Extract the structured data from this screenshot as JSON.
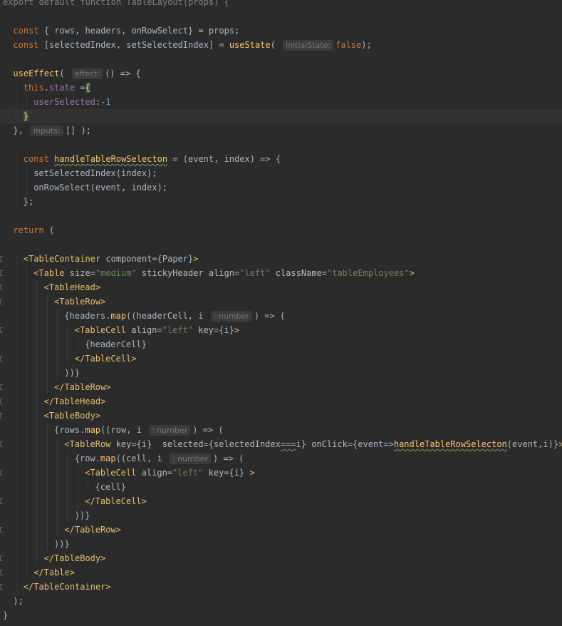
{
  "editor": {
    "colors": {
      "background": "#2b2b2b",
      "keyword": "#cc7832",
      "function": "#ffc66d",
      "string": "#6a8759",
      "jsx_tag": "#e8bf6a",
      "property": "#9876aa",
      "number": "#6897bb",
      "plain": "#a9b7c6",
      "hint_bg": "#3b3b3b"
    },
    "lines": [
      {
        "indent": 0,
        "current": false,
        "tokens": [
          {
            "t": "export default function TableLayout(props) {",
            "c": "dim"
          }
        ]
      },
      {
        "indent": 0,
        "tokens": []
      },
      {
        "indent": 1,
        "tokens": [
          {
            "t": "const",
            "c": "kw"
          },
          {
            "t": " { rows, headers, onRowSelect} = props;",
            "c": "plain"
          }
        ]
      },
      {
        "indent": 1,
        "tokens": [
          {
            "t": "const",
            "c": "kw"
          },
          {
            "t": " [selectedIndex, setSelectedIndex] = ",
            "c": "plain"
          },
          {
            "t": "useState",
            "c": "fn"
          },
          {
            "t": "( ",
            "c": "plain"
          },
          {
            "t": "initialState:",
            "c": "hint"
          },
          {
            "t": "false",
            "c": "kw"
          },
          {
            "t": ");",
            "c": "plain"
          }
        ]
      },
      {
        "indent": 0,
        "tokens": []
      },
      {
        "indent": 1,
        "tokens": [
          {
            "t": "useEffect",
            "c": "fn"
          },
          {
            "t": "( ",
            "c": "plain"
          },
          {
            "t": "effect:",
            "c": "hint"
          },
          {
            "t": "() => {",
            "c": "plain"
          }
        ]
      },
      {
        "indent": 2,
        "tokens": [
          {
            "t": "this",
            "c": "kw"
          },
          {
            "t": ".",
            "c": "plain"
          },
          {
            "t": "state",
            "c": "prop"
          },
          {
            "t": " =",
            "c": "plain"
          },
          {
            "t": "{",
            "c": "brace"
          }
        ]
      },
      {
        "indent": 3,
        "tokens": [
          {
            "t": "userSelected",
            "c": "prop"
          },
          {
            "t": ":-",
            "c": "plain"
          },
          {
            "t": "1",
            "c": "num"
          }
        ]
      },
      {
        "indent": 2,
        "current": true,
        "tokens": [
          {
            "t": "}",
            "c": "brace"
          }
        ]
      },
      {
        "indent": 1,
        "tokens": [
          {
            "t": "}, ",
            "c": "plain"
          },
          {
            "t": "inputs:",
            "c": "hint"
          },
          {
            "t": "[] );",
            "c": "plain"
          }
        ]
      },
      {
        "indent": 0,
        "tokens": []
      },
      {
        "indent": 2,
        "tokens": [
          {
            "t": "const ",
            "c": "kw"
          },
          {
            "t": "handleTableRowSelecton",
            "c": "fn-typo"
          },
          {
            "t": " = (event, index) => {",
            "c": "plain"
          }
        ]
      },
      {
        "indent": 3,
        "tokens": [
          {
            "t": "setSelectedIndex(index);",
            "c": "plain"
          }
        ]
      },
      {
        "indent": 3,
        "tokens": [
          {
            "t": "onRowSelect(event, index);",
            "c": "plain"
          }
        ]
      },
      {
        "indent": 2,
        "tokens": [
          {
            "t": "};",
            "c": "plain"
          }
        ]
      },
      {
        "indent": 0,
        "tokens": []
      },
      {
        "indent": 1,
        "tokens": [
          {
            "t": "return",
            "c": "kw"
          },
          {
            "t": " (",
            "c": "plain"
          }
        ]
      },
      {
        "indent": 0,
        "tokens": []
      },
      {
        "indent": 2,
        "tokens": [
          {
            "t": "<TableContainer ",
            "c": "tag"
          },
          {
            "t": "component",
            "c": "attr"
          },
          {
            "t": "={Paper}",
            "c": "plain"
          },
          {
            "t": ">",
            "c": "tag"
          }
        ]
      },
      {
        "indent": 3,
        "tokens": [
          {
            "t": "<Table ",
            "c": "tag"
          },
          {
            "t": "size",
            "c": "attr"
          },
          {
            "t": "=",
            "c": "plain"
          },
          {
            "t": "\"medium\"",
            "c": "str"
          },
          {
            "t": " stickyHeader ",
            "c": "attr"
          },
          {
            "t": "align",
            "c": "attr"
          },
          {
            "t": "=",
            "c": "plain"
          },
          {
            "t": "\"left\"",
            "c": "str"
          },
          {
            "t": " className",
            "c": "attr"
          },
          {
            "t": "=",
            "c": "plain"
          },
          {
            "t": "\"tableEmployees\"",
            "c": "str"
          },
          {
            "t": ">",
            "c": "tag"
          }
        ]
      },
      {
        "indent": 4,
        "tokens": [
          {
            "t": "<TableHead>",
            "c": "tag"
          }
        ]
      },
      {
        "indent": 5,
        "tokens": [
          {
            "t": "<TableRow>",
            "c": "tag"
          }
        ]
      },
      {
        "indent": 6,
        "tokens": [
          {
            "t": "{headers.",
            "c": "plain"
          },
          {
            "t": "map",
            "c": "fn"
          },
          {
            "t": "((headerCell, i ",
            "c": "plain"
          },
          {
            "t": ": number",
            "c": "hint"
          },
          {
            "t": ") => (",
            "c": "plain"
          }
        ]
      },
      {
        "indent": 7,
        "tokens": [
          {
            "t": "<TableCell ",
            "c": "tag"
          },
          {
            "t": "align",
            "c": "attr"
          },
          {
            "t": "=",
            "c": "plain"
          },
          {
            "t": "\"left\"",
            "c": "str"
          },
          {
            "t": " key",
            "c": "attr"
          },
          {
            "t": "={i}",
            "c": "plain"
          },
          {
            "t": ">",
            "c": "tag"
          }
        ]
      },
      {
        "indent": 8,
        "tokens": [
          {
            "t": "{headerCell}",
            "c": "plain"
          }
        ]
      },
      {
        "indent": 7,
        "tokens": [
          {
            "t": "</TableCell>",
            "c": "tag"
          }
        ]
      },
      {
        "indent": 6,
        "tokens": [
          {
            "t": "))}",
            "c": "plain"
          }
        ]
      },
      {
        "indent": 5,
        "tokens": [
          {
            "t": "</TableRow>",
            "c": "tag"
          }
        ]
      },
      {
        "indent": 4,
        "tokens": [
          {
            "t": "</TableHead>",
            "c": "tag"
          }
        ]
      },
      {
        "indent": 4,
        "tokens": [
          {
            "t": "<TableBody>",
            "c": "tag"
          }
        ]
      },
      {
        "indent": 5,
        "tokens": [
          {
            "t": "{rows.",
            "c": "plain"
          },
          {
            "t": "map",
            "c": "fn"
          },
          {
            "t": "((row, i ",
            "c": "plain"
          },
          {
            "t": ": number",
            "c": "hint"
          },
          {
            "t": ") => (",
            "c": "plain"
          }
        ]
      },
      {
        "indent": 6,
        "tokens": [
          {
            "t": "<TableRow ",
            "c": "tag"
          },
          {
            "t": "key",
            "c": "attr"
          },
          {
            "t": "={i}  ",
            "c": "plain"
          },
          {
            "t": "selected",
            "c": "attr"
          },
          {
            "t": "={selectedIndex",
            "c": "plain"
          },
          {
            "t": "===",
            "c": "plain-typo"
          },
          {
            "t": "i} ",
            "c": "plain"
          },
          {
            "t": "onClick",
            "c": "attr"
          },
          {
            "t": "={event=>",
            "c": "plain"
          },
          {
            "t": "handleTableRowSelecton",
            "c": "fn-typo"
          },
          {
            "t": "(event,i)}",
            "c": "plain"
          },
          {
            "t": ">",
            "c": "tag"
          }
        ]
      },
      {
        "indent": 7,
        "tokens": [
          {
            "t": "{row.",
            "c": "plain"
          },
          {
            "t": "map",
            "c": "fn"
          },
          {
            "t": "((cell, i ",
            "c": "plain"
          },
          {
            "t": ": number",
            "c": "hint"
          },
          {
            "t": ") => (",
            "c": "plain"
          }
        ]
      },
      {
        "indent": 8,
        "tokens": [
          {
            "t": "<TableCell ",
            "c": "tag"
          },
          {
            "t": "align",
            "c": "attr"
          },
          {
            "t": "=",
            "c": "plain"
          },
          {
            "t": "\"left\"",
            "c": "str"
          },
          {
            "t": " key",
            "c": "attr"
          },
          {
            "t": "={i} ",
            "c": "plain"
          },
          {
            "t": ">",
            "c": "tag"
          }
        ]
      },
      {
        "indent": 9,
        "tokens": [
          {
            "t": "{cell}",
            "c": "plain"
          }
        ]
      },
      {
        "indent": 8,
        "tokens": [
          {
            "t": "</TableCell>",
            "c": "tag"
          }
        ]
      },
      {
        "indent": 7,
        "tokens": [
          {
            "t": "))}",
            "c": "plain"
          }
        ]
      },
      {
        "indent": 6,
        "tokens": [
          {
            "t": "</TableRow>",
            "c": "tag"
          }
        ]
      },
      {
        "indent": 5,
        "tokens": [
          {
            "t": "))}",
            "c": "plain"
          }
        ]
      },
      {
        "indent": 4,
        "tokens": [
          {
            "t": "</TableBody>",
            "c": "tag"
          }
        ]
      },
      {
        "indent": 3,
        "tokens": [
          {
            "t": "</Table>",
            "c": "tag"
          }
        ]
      },
      {
        "indent": 2,
        "tokens": [
          {
            "t": "</TableContainer>",
            "c": "tag"
          }
        ]
      },
      {
        "indent": 1,
        "tokens": [
          {
            "t": ");",
            "c": "plain"
          }
        ]
      },
      {
        "indent": 0,
        "tokens": [
          {
            "t": "}",
            "c": "plain"
          }
        ]
      }
    ]
  }
}
